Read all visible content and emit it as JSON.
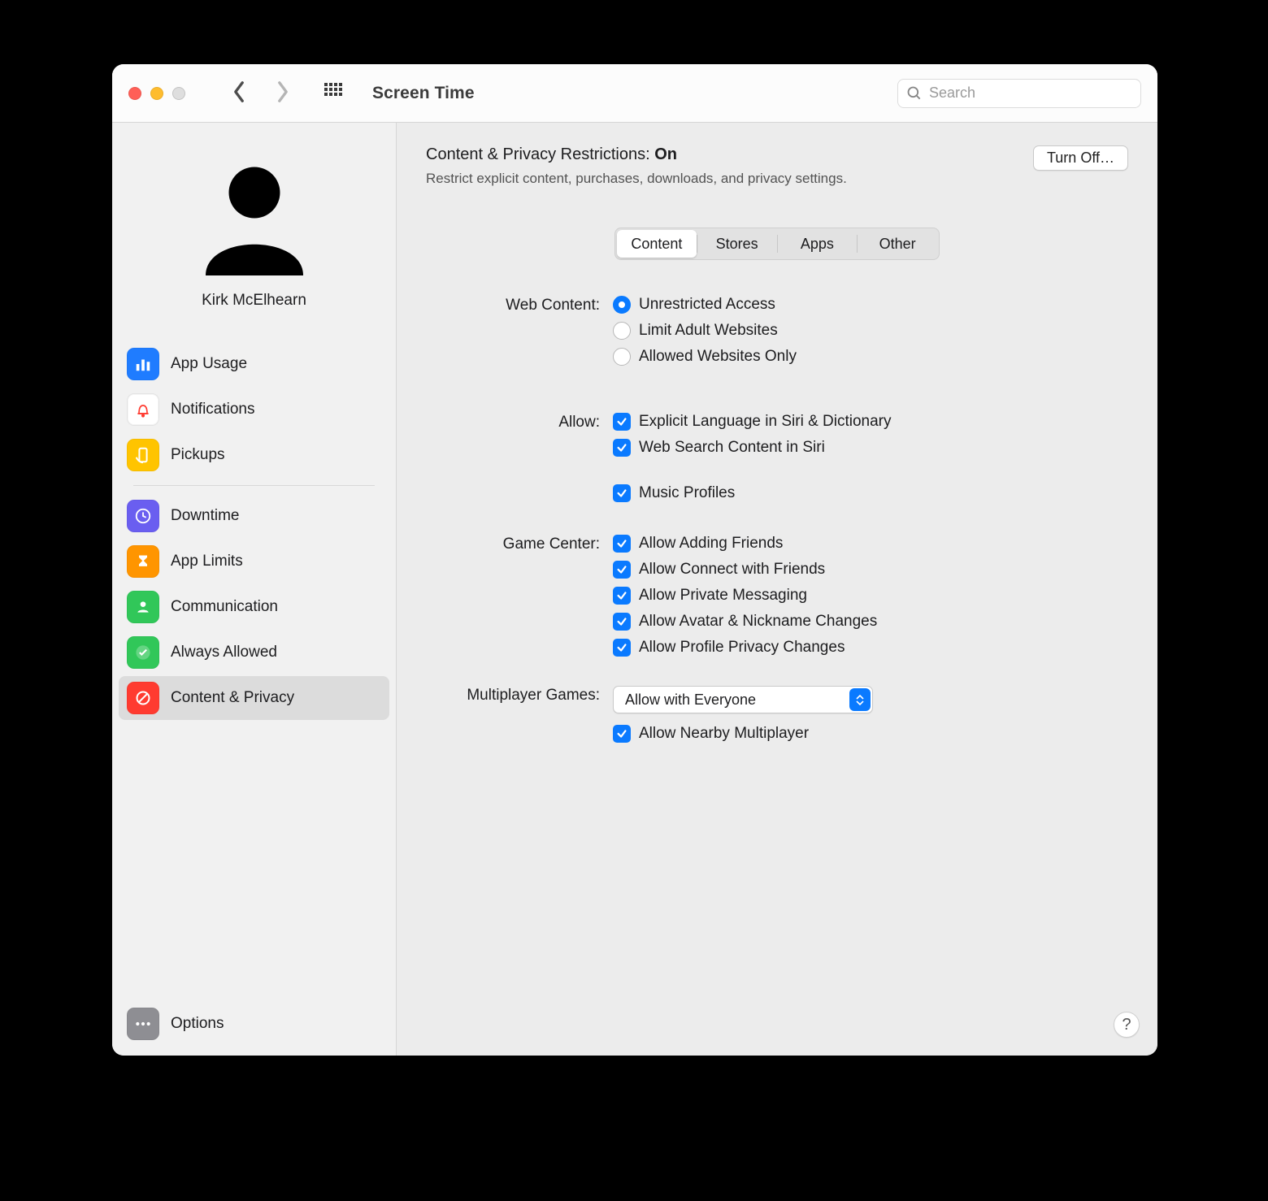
{
  "window": {
    "title": "Screen Time",
    "search_placeholder": "Search"
  },
  "profile": {
    "name": "Kirk McElhearn"
  },
  "sidebar": {
    "group1": [
      {
        "label": "App Usage"
      },
      {
        "label": "Notifications"
      },
      {
        "label": "Pickups"
      }
    ],
    "group2": [
      {
        "label": "Downtime"
      },
      {
        "label": "App Limits"
      },
      {
        "label": "Communication"
      },
      {
        "label": "Always Allowed"
      },
      {
        "label": "Content & Privacy"
      }
    ],
    "options_label": "Options"
  },
  "header": {
    "title_prefix": "Content & Privacy Restrictions: ",
    "status": "On",
    "subtitle": "Restrict explicit content, purchases, downloads, and privacy settings.",
    "turn_off_label": "Turn Off…"
  },
  "tabs": [
    "Content",
    "Stores",
    "Apps",
    "Other"
  ],
  "web_content": {
    "label": "Web Content:",
    "options": [
      "Unrestricted Access",
      "Limit Adult Websites",
      "Allowed Websites Only"
    ]
  },
  "allow": {
    "label": "Allow:",
    "options": [
      "Explicit Language in Siri & Dictionary",
      "Web Search Content in Siri",
      "Music Profiles"
    ]
  },
  "game_center": {
    "label": "Game Center:",
    "options": [
      "Allow Adding Friends",
      "Allow Connect with Friends",
      "Allow Private Messaging",
      "Allow Avatar & Nickname Changes",
      "Allow Profile Privacy Changes"
    ]
  },
  "multiplayer": {
    "label": "Multiplayer Games:",
    "selected": "Allow with Everyone",
    "nearby": "Allow Nearby Multiplayer"
  },
  "help_label": "?"
}
